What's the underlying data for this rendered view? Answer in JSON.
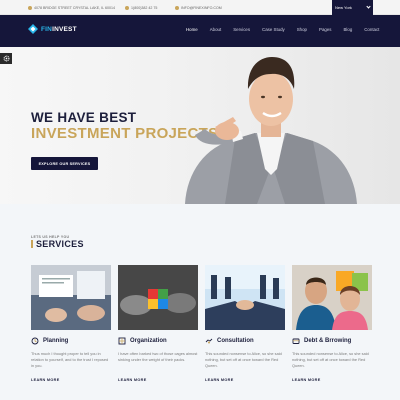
{
  "topbar": {
    "address": "4078 BRIDGE STREET CRYSTAL LAKE, IL 60014",
    "phone": "1(800)382 42 75",
    "email": "INFO@FINEXINFO.COM",
    "city": "New York"
  },
  "header": {
    "logo_prefix": "FIN",
    "logo_suffix": "INVEST",
    "nav": [
      "Home",
      "About",
      "Services",
      "Case Study",
      "Shop",
      "Pages",
      "Blog",
      "Contact"
    ]
  },
  "hero": {
    "line1": "WE HAVE BEST",
    "line2": "INVESTMENT PROJECTS",
    "cta": "EXPLORE OUR SERVICES"
  },
  "services": {
    "eyebrow": "LETS US HELP YOU",
    "title": "SERVICES",
    "cards": [
      {
        "title": "Planning",
        "desc": "Thus much I thought proper to tell you in relation to yourself, and to the trust I reposed in you.",
        "more": "LEARN MORE",
        "icon": "planning-icon"
      },
      {
        "title": "Organization",
        "desc": "I have often barked two of those cages almost sinking under the weight of their packs.",
        "more": "LEARN MORE",
        "icon": "organization-icon"
      },
      {
        "title": "Consultation",
        "desc": "This sounded nonsense to Alice, so she said nothing, but set off at once toward the Red Queen.",
        "more": "LEARN MORE",
        "icon": "handshake-icon"
      },
      {
        "title": "Debt & Brrowing",
        "desc": "This sounded nonsense to Alice, so she said nothing, but set off at once toward the Red Queen.",
        "more": "LEARN MORE",
        "icon": "debt-icon"
      }
    ]
  },
  "colors": {
    "navy": "#15163a",
    "gold": "#c9a55a",
    "accent_blue": "#29b6ea"
  }
}
